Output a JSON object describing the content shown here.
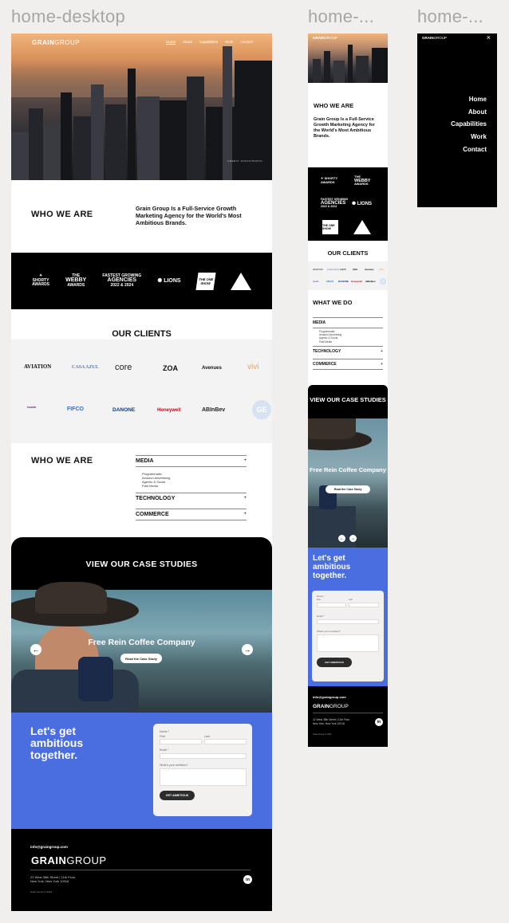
{
  "frames": {
    "desktop": "home-desktop",
    "tablet": "home-...",
    "mobile": "home-..."
  },
  "brand": {
    "bold": "GRAIN",
    "regular": "GROUP"
  },
  "nav": {
    "home": "Home",
    "about": "About",
    "capabilities": "Capabilities",
    "work": "Work",
    "contact": "Contact"
  },
  "hero_caption": "CREDIT: STOCK/PHOTO",
  "who": {
    "heading": "WHO WE ARE",
    "text": "Grain Group Is a Full-Service Growth Marketing Agency for the World's Most Ambitious Brands."
  },
  "awards": [
    {
      "line1": "SHORTY",
      "line2": "AWARDS"
    },
    {
      "line1": "THE",
      "line2": "WEBBY",
      "line3": "AWARDS"
    },
    {
      "line1": "FASTEST GROWING",
      "line2": "AGENCIES",
      "line3": "2022 & 2024"
    },
    {
      "line1": "LIONS"
    },
    {
      "line1": "THE ONE SHOW"
    },
    {
      "line1": "CLIO"
    }
  ],
  "clients": {
    "heading": "OUR CLIENTS",
    "row1": [
      "AVIATION",
      "CASA AZUL",
      "core",
      "ZOA",
      "Avenues",
      "vivi"
    ],
    "row2": [
      "Isaiah",
      "FIFCO",
      "DANONE",
      "Honeywell",
      "ABInBev",
      "GE"
    ]
  },
  "what": {
    "heading_desktop": "WHO WE ARE",
    "heading_tablet": "WHAT WE DO",
    "media": "MEDIA",
    "media_items": [
      "Programmatic",
      "Amazon Advertising",
      "Agentic & Social",
      "Paid Media"
    ],
    "technology": "TECHNOLOGY",
    "commerce": "COMMERCE",
    "plus": "+"
  },
  "case": {
    "heading": "VIEW OUR CASE STUDIES",
    "title": "Free Rein Coffee Company",
    "button": "Read the Case Study",
    "prev": "←",
    "next": "→"
  },
  "cta": {
    "heading": "Let's get ambitious together.",
    "name_label": "Name *",
    "first_label": "First",
    "last_label": "Last",
    "email_label": "Email *",
    "ambition_label": "What's your ambition?",
    "submit": "GET AMBITIOUS"
  },
  "footer": {
    "email": "info@graingroup.com",
    "address1": "22 West 38th Street | 11th Floor",
    "address2": "New York, New York 10018",
    "copyright": "Grain Group © 2024",
    "linkedin": "in"
  },
  "mobile_menu": [
    "Home",
    "About",
    "Capabilities",
    "Work",
    "Contact"
  ],
  "close_glyph": "×"
}
